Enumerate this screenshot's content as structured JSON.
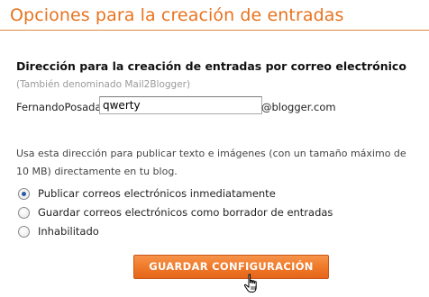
{
  "header": {
    "title": "Opciones para la creación de entradas"
  },
  "email_section": {
    "heading": "Dirección para la creación de entradas por correo electrónico",
    "subheading": "(También denominado Mail2Blogger)",
    "prefix": "FernandoPosada.",
    "input_value": "qwerty",
    "suffix": "@blogger.com"
  },
  "description": "Usa esta dirección para publicar texto e imágenes (con un tamaño máximo de 10 MB) directamente en tu blog.",
  "options": [
    {
      "label": "Publicar correos electrónicos inmediatamente",
      "checked": true
    },
    {
      "label": "Guardar correos electrónicos como borrador de entradas",
      "checked": false
    },
    {
      "label": "Inhabilitado",
      "checked": false
    }
  ],
  "save_button": {
    "label": "GUARDAR CONFIGURACIÓN"
  },
  "colors": {
    "accent": "#e8731e",
    "button_top": "#f6934a",
    "button_bottom": "#e5651a",
    "radio_dot": "#2a5aa8"
  },
  "icons": {
    "cursor": "hand-pointer-icon"
  }
}
